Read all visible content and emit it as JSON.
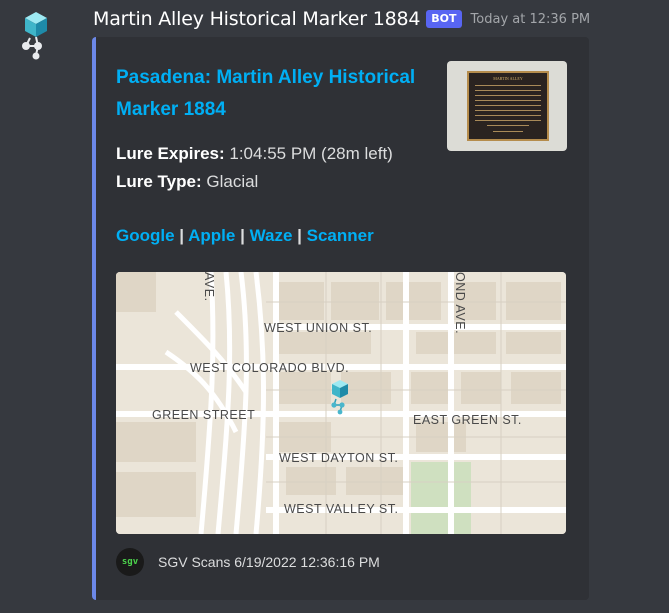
{
  "message": {
    "author": "Martin Alley Historical Marker 1884",
    "bot_tag": "BOT",
    "timestamp": "Today at 12:36 PM"
  },
  "embed": {
    "title": "Pasadena: Martin Alley Historical Marker 1884",
    "fields": {
      "lure_expires_label": "Lure Expires:",
      "lure_expires_value": " 1:04:55 PM (28m left)",
      "lure_type_label": "Lure Type:",
      "lure_type_value": " Glacial"
    },
    "links": [
      {
        "label": "Google"
      },
      {
        "label": "Apple"
      },
      {
        "label": "Waze"
      },
      {
        "label": "Scanner"
      }
    ],
    "link_separator": " | ",
    "thumbnail": {
      "plaque_title": "MARTIN ALLEY"
    },
    "map": {
      "street_labels": {
        "west_union": "WEST UNION ST.",
        "west_colorado": "WEST COLORADO BLVD.",
        "green_street": "GREEN STREET",
        "east_green": "EAST GREEN ST.",
        "west_dayton": "WEST DAYTON ST.",
        "west_valley": "WEST VALLEY ST.",
        "raymond_ave_fragment": "OND AVE.",
        "left_ave_fragment": "AVE."
      }
    },
    "footer": {
      "icon_text": "sgv",
      "text": "SGV Scans 6/19/2022 12:36:16 PM"
    }
  },
  "colors": {
    "background": "#36393f",
    "embed_background": "#2f3136",
    "embed_border": "#6c88e8",
    "link": "#00aff4",
    "bot_tag": "#5865f2"
  }
}
